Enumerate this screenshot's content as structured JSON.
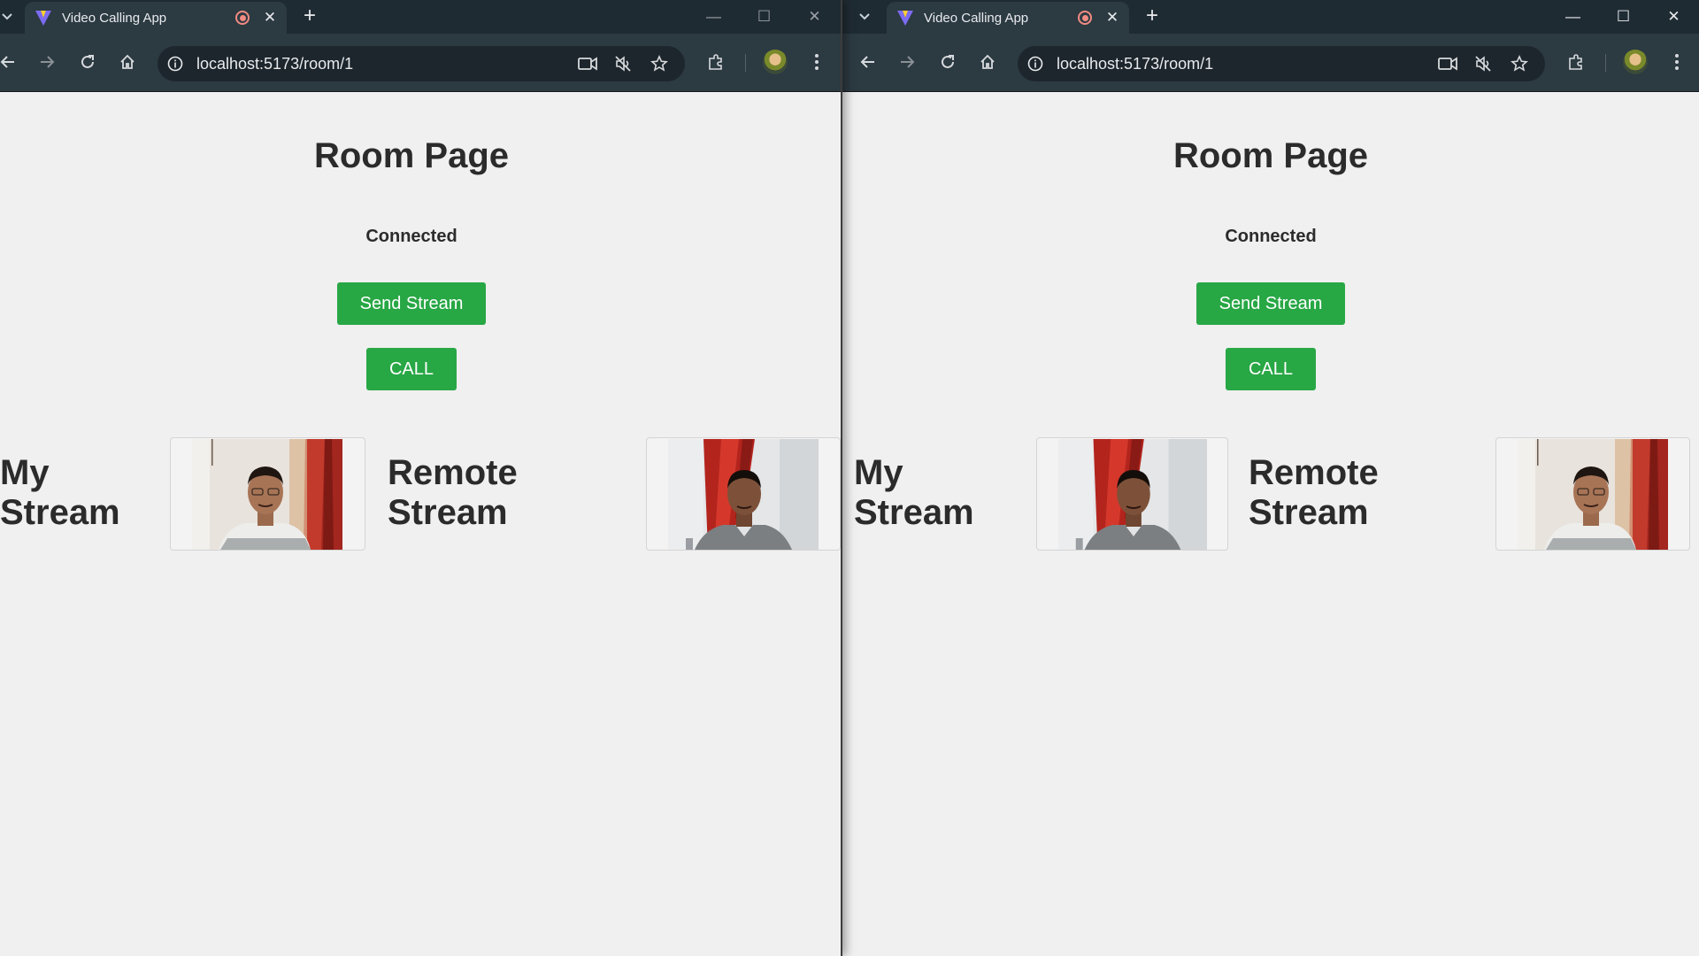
{
  "browser_left": {
    "tab_title": "Video Calling App",
    "url": "localhost:5173/room/1"
  },
  "browser_right": {
    "tab_title": "Video Calling App",
    "url": "localhost:5173/room/1"
  },
  "page_left": {
    "title": "Room Page",
    "status": "Connected",
    "send_stream_label": "Send Stream",
    "call_label": "CALL",
    "my_stream_line1": "My",
    "my_stream_line2": "Stream",
    "remote_stream_line1": "Remote",
    "remote_stream_line2": "Stream"
  },
  "page_right": {
    "title": "Room Page",
    "status": "Connected",
    "send_stream_label": "Send Stream",
    "call_label": "CALL",
    "my_stream_line1": "My",
    "my_stream_line2": "Stream",
    "remote_stream_line1": "Remote",
    "remote_stream_line2": "Stream"
  },
  "colors": {
    "button_green": "#28a745",
    "page_background": "#f0f0f0",
    "chrome_dark": "#1f2b33",
    "toolbar": "#2c3a42",
    "recording_red": "#f28b82"
  },
  "icons": [
    "tab-search-icon",
    "app-favicon-icon",
    "recording-icon",
    "close-icon",
    "new-tab-icon",
    "minimize-icon",
    "maximize-icon",
    "window-close-icon",
    "back-icon",
    "forward-icon",
    "reload-icon",
    "home-icon",
    "site-info-icon",
    "camera-icon",
    "mic-off-icon",
    "bookmark-star-icon",
    "extensions-icon",
    "profile-avatar",
    "menu-icon"
  ]
}
